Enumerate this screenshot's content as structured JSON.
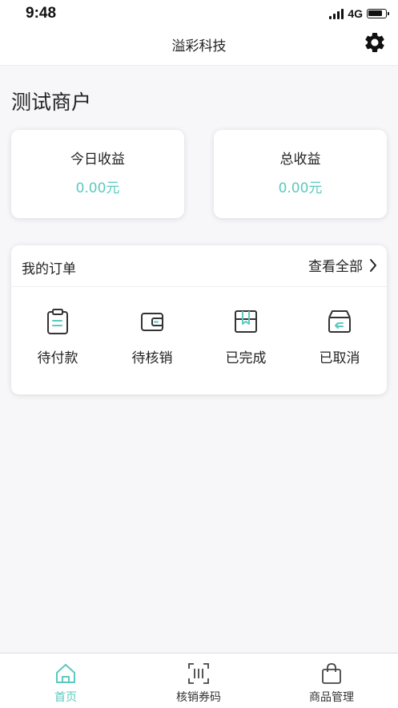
{
  "status_bar": {
    "time": "9:48",
    "network": "4G"
  },
  "nav": {
    "title": "溢彩科技",
    "settings_icon": "gear-icon"
  },
  "merchant": {
    "name": "测试商户"
  },
  "stats": [
    {
      "label": "今日收益",
      "value": "0.00元"
    },
    {
      "label": "总收益",
      "value": "0.00元"
    }
  ],
  "orders": {
    "title": "我的订单",
    "view_all": "查看全部",
    "items": [
      {
        "label": "待付款",
        "icon": "clipboard-icon"
      },
      {
        "label": "待核销",
        "icon": "wallet-icon"
      },
      {
        "label": "已完成",
        "icon": "bookmark-box-icon"
      },
      {
        "label": "已取消",
        "icon": "return-box-icon"
      }
    ]
  },
  "tabs": [
    {
      "label": "首页",
      "icon": "home-icon",
      "active": true
    },
    {
      "label": "核销券码",
      "icon": "scan-icon",
      "active": false
    },
    {
      "label": "商品管理",
      "icon": "bag-icon",
      "active": false
    }
  ],
  "colors": {
    "accent": "#5bc9bf",
    "background": "#f7f7f9",
    "card": "#ffffff"
  }
}
